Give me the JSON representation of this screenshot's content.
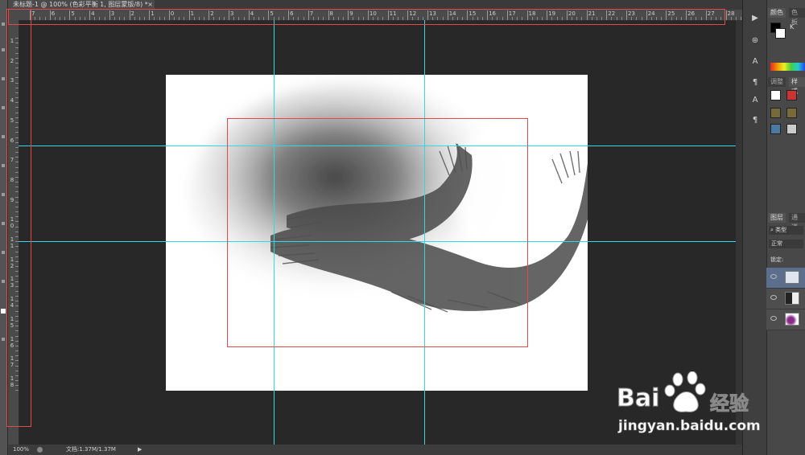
{
  "document": {
    "tab_title": "未标题-1 @ 100% (色彩平衡 1, 图层蒙版/8) *",
    "close_label": "×"
  },
  "ruler": {
    "h_labels": [
      "7",
      "6",
      "5",
      "4",
      "3",
      "2",
      "1",
      "0",
      "1",
      "2",
      "3",
      "4",
      "5",
      "6",
      "7",
      "8",
      "9",
      "10",
      "11",
      "12",
      "13",
      "14",
      "15",
      "16",
      "17",
      "18",
      "19",
      "20",
      "21",
      "22",
      "23",
      "24",
      "25",
      "26",
      "27",
      "28"
    ],
    "v_labels": [
      "1",
      "2",
      "3",
      "4",
      "5",
      "6",
      "7",
      "8",
      "9",
      "10",
      "11",
      "12",
      "13",
      "14",
      "15",
      "16",
      "17",
      "18"
    ]
  },
  "status": {
    "zoom": "100%",
    "doc_info": "文档:1.37M/1.37M",
    "arrow": "▶"
  },
  "panels": {
    "color_tab": "颜色",
    "swatches_tab": "色板",
    "k_label": "K",
    "adjust_tab": "调整",
    "styles_tab": "样式",
    "layers_tab": "图层",
    "channels_tab": "通道",
    "filter_kind": "类型",
    "blend_mode": "正常",
    "lock_label": "锁定:"
  },
  "dock_icons": [
    "play-icon",
    "history-icon",
    "character-icon",
    "paragraph-styles-icon",
    "character-styles-icon",
    "paragraph-icon"
  ],
  "watermark": {
    "brand": "Bai",
    "brand2": "经验",
    "url": "jingyan.baidu.com"
  },
  "colors": {
    "guide": "#36d5e3",
    "annotation": "#e04a4a",
    "foreground": "#000000",
    "background": "#ffffff"
  }
}
